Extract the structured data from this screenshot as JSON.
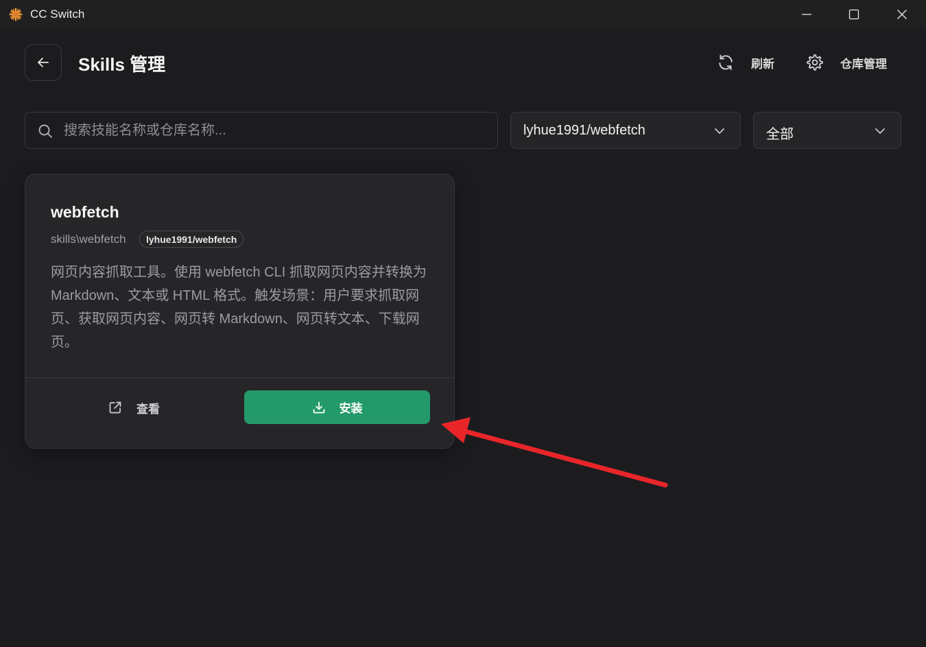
{
  "window": {
    "title": "CC Switch",
    "logo_icon": "sunburst-logo-icon",
    "controls": [
      "minimize-icon",
      "maximize-icon",
      "close-icon"
    ]
  },
  "header": {
    "title": "Skills 管理",
    "refresh_label": "刷新",
    "repo_manage_label": "仓库管理"
  },
  "filters": {
    "search_placeholder": "搜索技能名称或仓库名称...",
    "search_value": "",
    "repo_selected": "lyhue1991/webfetch",
    "category_selected": "全部"
  },
  "skills": [
    {
      "name": "webfetch",
      "path": "skills\\webfetch",
      "repo": "lyhue1991/webfetch",
      "description": "网页内容抓取工具。使用 webfetch CLI 抓取网页内容并转换为 Markdown、文本或 HTML 格式。触发场景：用户要求抓取网页、获取网页内容、网页转 Markdown、网页转文本、下载网页。",
      "view_label": "查看",
      "install_label": "安装"
    }
  ],
  "colors": {
    "background": "#1c1c1f",
    "card": "#262629",
    "install_button": "#249a6a",
    "annotation_arrow": "#e8262a"
  }
}
